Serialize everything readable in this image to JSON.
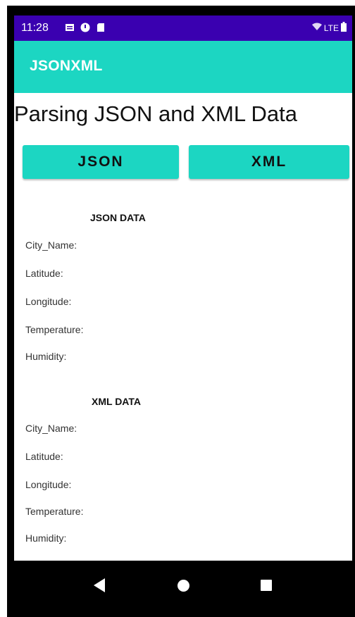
{
  "status_bar": {
    "time": "11:28",
    "network": "LTE"
  },
  "app_bar": {
    "title": "JSONXML"
  },
  "main": {
    "title": "Parsing JSON and XML Data",
    "json_button_label": "JSON",
    "xml_button_label": "XML",
    "json_section": {
      "header": "JSON DATA",
      "fields": [
        "City_Name:",
        "Latitude:",
        "Longitude:",
        "Temperature:",
        "Humidity:"
      ]
    },
    "xml_section": {
      "header": "XML DATA",
      "fields": [
        "City_Name:",
        "Latitude:",
        "Longitude:",
        "Temperature:",
        "Humidity:"
      ]
    }
  },
  "colors": {
    "status_bar": "#3a00b0",
    "accent": "#1cd6c2"
  }
}
